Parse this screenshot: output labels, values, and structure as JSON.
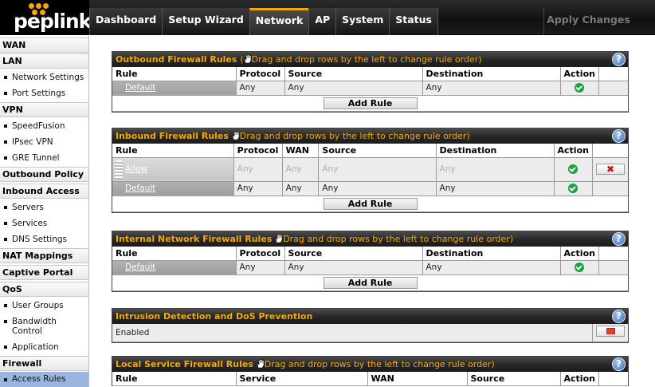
{
  "brand": "peplink",
  "nav": {
    "tabs": [
      "Dashboard",
      "Setup Wizard",
      "Network",
      "AP",
      "System",
      "Status"
    ],
    "active": "Network",
    "apply": "Apply Changes"
  },
  "sidebar": {
    "wan": "WAN",
    "lan": "LAN",
    "network_settings": "Network Settings",
    "port_settings": "Port Settings",
    "vpn": "VPN",
    "speedfusion": "SpeedFusion",
    "ipsec_vpn": "IPsec VPN",
    "gre_tunnel": "GRE Tunnel",
    "outbound_policy": "Outbound Policy",
    "inbound_access": "Inbound Access",
    "servers": "Servers",
    "services": "Services",
    "dns_settings": "DNS Settings",
    "nat_mappings": "NAT Mappings",
    "captive_portal": "Captive Portal",
    "qos": "QoS",
    "user_groups": "User Groups",
    "bandwidth_control_1": "Bandwidth",
    "bandwidth_control_2": "Control",
    "application": "Application",
    "firewall": "Firewall",
    "access_rules": "Access Rules"
  },
  "drag_note": "Drag and drop rows by the left to change rule order)",
  "outbound": {
    "title": "Outbound Firewall Rules",
    "cols": [
      "Rule",
      "Protocol",
      "Source",
      "Destination",
      "Action"
    ],
    "rows": [
      {
        "rule": "Default",
        "protocol": "Any",
        "source": "Any",
        "destination": "Any",
        "action": "allow"
      }
    ],
    "add": "Add Rule"
  },
  "inbound": {
    "title": "Inbound Firewall Rules",
    "cols": [
      "Rule",
      "Protocol",
      "WAN",
      "Source",
      "Destination",
      "Action"
    ],
    "rows": [
      {
        "rule": "Allow",
        "protocol": "Any",
        "wan": "Any",
        "source": "Any",
        "destination": "Any",
        "action": "allow"
      },
      {
        "rule": "Default",
        "protocol": "Any",
        "wan": "Any",
        "source": "Any",
        "destination": "Any",
        "action": "allow"
      }
    ],
    "add": "Add Rule"
  },
  "internal": {
    "title": "Internal Network Firewall Rules",
    "cols": [
      "Rule",
      "Protocol",
      "Source",
      "Destination",
      "Action"
    ],
    "rows": [
      {
        "rule": "Default",
        "protocol": "Any",
        "source": "Any",
        "destination": "Any",
        "action": "allow"
      }
    ],
    "add": "Add Rule"
  },
  "ids": {
    "title": "Intrusion Detection and DoS Prevention",
    "status": "Enabled"
  },
  "local": {
    "title": "Local Service Firewall Rules",
    "cols": [
      "Rule",
      "Service",
      "WAN",
      "Source",
      "Action"
    ]
  },
  "colors": {
    "accent": "#f5a800",
    "header_bg": "#262626",
    "selected_nav": "#9ab6de",
    "allow_green": "#17a43a",
    "delete_red": "#d21010"
  }
}
